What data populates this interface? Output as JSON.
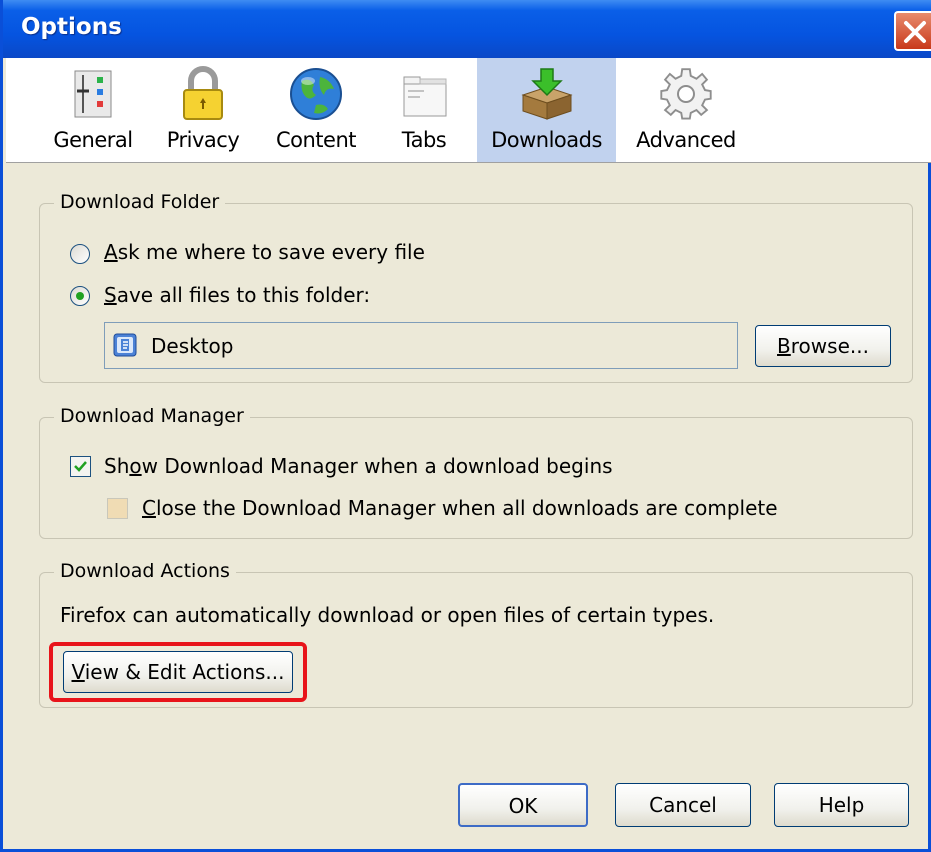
{
  "window": {
    "title": "Options"
  },
  "toolbar": {
    "tabs": [
      {
        "label": "General",
        "icon": "general-sliders-icon"
      },
      {
        "label": "Privacy",
        "icon": "padlock-icon"
      },
      {
        "label": "Content",
        "icon": "globe-icon"
      },
      {
        "label": "Tabs",
        "icon": "tabs-window-icon"
      },
      {
        "label": "Downloads",
        "icon": "downloads-box-icon",
        "selected": true
      },
      {
        "label": "Advanced",
        "icon": "gear-icon"
      }
    ]
  },
  "download_folder": {
    "title": "Download Folder",
    "ask_option": {
      "mnemonic": "A",
      "rest": "sk me where to save every file",
      "selected": false
    },
    "save_option": {
      "mnemonic": "S",
      "rest": "ave all files to this folder:",
      "selected": true
    },
    "folder_value": "Desktop",
    "browse_button": {
      "mnemonic": "B",
      "rest": "rowse..."
    }
  },
  "download_manager": {
    "title": "Download Manager",
    "show_option": {
      "pre": "Sh",
      "mnemonic": "o",
      "rest": "w Download Manager when a download begins",
      "checked": true
    },
    "close_option": {
      "mnemonic": "C",
      "rest": "lose the Download Manager when all downloads are complete",
      "checked": false,
      "enabled": false
    }
  },
  "download_actions": {
    "title": "Download Actions",
    "description": "Firefox can automatically download or open files of certain types.",
    "view_edit_button": {
      "mnemonic": "V",
      "rest": "iew & Edit Actions..."
    }
  },
  "footer": {
    "ok": "OK",
    "cancel": "Cancel",
    "help": "Help"
  },
  "colors": {
    "titlebar": "#0554e0",
    "selected_tab": "#c1d2ee",
    "highlight": "#e8141a",
    "radio_dot": "#21a121"
  }
}
